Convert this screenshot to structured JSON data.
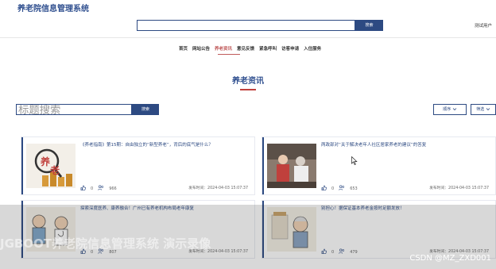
{
  "header": {
    "site_title": "养老院信息管理系统",
    "search_button": "搜索",
    "user": "测试用户"
  },
  "nav": [
    "首页",
    "网站公告",
    "养老资讯",
    "意见反馈",
    "紧急呼叫",
    "访客申请",
    "入住服务"
  ],
  "section": {
    "title": "养老资讯",
    "search_placeholder": "标题搜索",
    "search_button": "搜索",
    "sort_label": "顺序",
    "filter_label": "筛选"
  },
  "cards": [
    {
      "title": "《养老指南》第15期：自由独立的“新型养老”，背后的底气是什么？",
      "likes": "0",
      "views": "966",
      "date": "发布时间：2024-04-03 15:07:37"
    },
    {
      "title": "两政部对“关于解决老年人社区居家养老的建议”的答复",
      "likes": "0",
      "views": "653",
      "date": "发布时间：2024-04-03 15:07:37"
    },
    {
      "title": "探索深度医养、康养融合！广州已有养老机构布局老年康复",
      "likes": "0",
      "views": "807",
      "date": "发布时间：2024-04-03 15:07:37"
    },
    {
      "title": "别担心！据保证基本养老金按时足额发放！",
      "likes": "0",
      "views": "479",
      "date": "发布时间：2024-04-03 15:07:37"
    }
  ],
  "watermark": "JGBOOT养老院信息管理系统 演示录像",
  "csdn_mark": "CSDN @MZ_ZXD001",
  "colors": {
    "primary": "#2d4a82",
    "accent": "#c0403c"
  }
}
